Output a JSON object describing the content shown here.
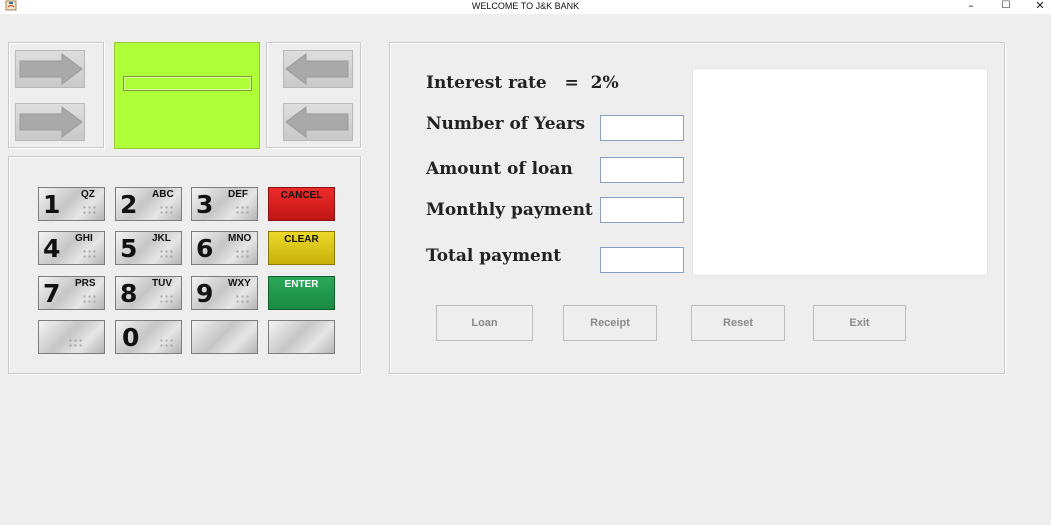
{
  "window": {
    "title": "WELCOME TO J&K BANK",
    "minimize_glyph": "–",
    "maximize_glyph": "☐",
    "close_glyph": "✕"
  },
  "screen": {
    "value": ""
  },
  "keypad": {
    "keys": [
      {
        "num": "1",
        "letters": "QZ"
      },
      {
        "num": "2",
        "letters": "ABC"
      },
      {
        "num": "3",
        "letters": "DEF"
      },
      {
        "num": "4",
        "letters": "GHI"
      },
      {
        "num": "5",
        "letters": "JKL"
      },
      {
        "num": "6",
        "letters": "MNO"
      },
      {
        "num": "7",
        "letters": "PRS"
      },
      {
        "num": "8",
        "letters": "TUV"
      },
      {
        "num": "9",
        "letters": "WXY"
      },
      {
        "num": "0",
        "letters": ""
      }
    ],
    "cancel_label": "CANCEL",
    "clear_label": "CLEAR",
    "enter_label": "ENTER"
  },
  "form": {
    "interest_rate_label": "Interest rate",
    "interest_rate_equals": "=",
    "interest_rate_value": "2%",
    "years_label": "Number of Years",
    "years_value": "",
    "loan_amount_label": "Amount of loan",
    "loan_amount_value": "",
    "monthly_payment_label": "Monthly payment",
    "monthly_payment_value": "",
    "total_payment_label": "Total payment",
    "total_payment_value": ""
  },
  "actions": {
    "loan_label": "Loan",
    "receipt_label": "Receipt",
    "reset_label": "Reset",
    "exit_label": "Exit"
  },
  "colors": {
    "screen": "#aeff38",
    "cancel": "#d81e1e",
    "clear": "#d9c31a",
    "enter": "#22994e"
  }
}
